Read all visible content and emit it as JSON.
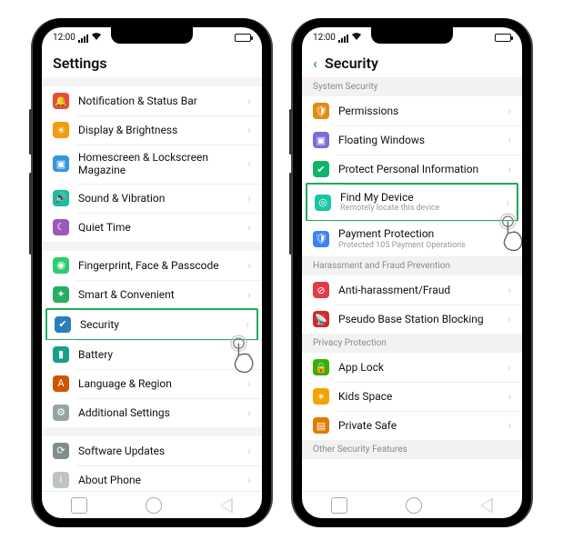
{
  "status": {
    "time": "12:00"
  },
  "phone1": {
    "title": "Settings",
    "groups": [
      {
        "items": [
          {
            "key": "notification",
            "label": "Notification & Status Bar"
          },
          {
            "key": "display",
            "label": "Display & Brightness"
          },
          {
            "key": "homescreen",
            "label": "Homescreen & Lockscreen Magazine"
          },
          {
            "key": "sound",
            "label": "Sound & Vibration"
          },
          {
            "key": "quiet",
            "label": "Quiet Time"
          }
        ]
      },
      {
        "items": [
          {
            "key": "fingerprint",
            "label": "Fingerprint, Face & Passcode"
          },
          {
            "key": "smart",
            "label": "Smart & Convenient"
          },
          {
            "key": "security",
            "label": "Security",
            "highlight": true
          },
          {
            "key": "battery",
            "label": "Battery"
          },
          {
            "key": "language",
            "label": "Language & Region"
          },
          {
            "key": "additional",
            "label": "Additional Settings"
          }
        ]
      },
      {
        "items": [
          {
            "key": "updates",
            "label": "Software Updates"
          },
          {
            "key": "about",
            "label": "About Phone"
          }
        ]
      }
    ]
  },
  "phone2": {
    "title": "Security",
    "sections": [
      {
        "header": "System Security",
        "items": [
          {
            "key": "permissions",
            "label": "Permissions"
          },
          {
            "key": "floating",
            "label": "Floating Windows"
          },
          {
            "key": "protectinfo",
            "label": "Protect Personal Information"
          },
          {
            "key": "findmy",
            "label": "Find My Device",
            "sublabel": "Remotely locate this device",
            "highlight": true
          },
          {
            "key": "payment",
            "label": "Payment Protection",
            "sublabel": "Protected 105 Payment Operations"
          }
        ]
      },
      {
        "header": "Harassment and Fraud Prevention",
        "items": [
          {
            "key": "antiharass",
            "label": "Anti-harassment/Fraud"
          },
          {
            "key": "pseudo",
            "label": "Pseudo Base Station Blocking"
          }
        ]
      },
      {
        "header": "Privacy Protection",
        "items": [
          {
            "key": "applock",
            "label": "App Lock"
          },
          {
            "key": "kids",
            "label": "Kids Space"
          },
          {
            "key": "private",
            "label": "Private Safe"
          }
        ]
      },
      {
        "header": "Other Security Features",
        "items": []
      }
    ]
  }
}
